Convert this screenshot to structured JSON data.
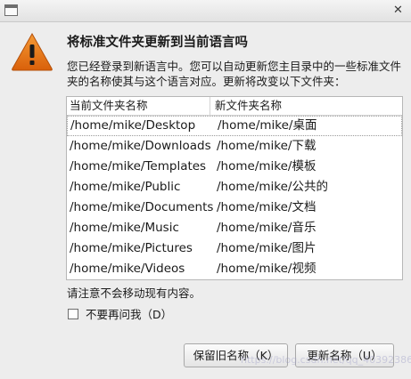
{
  "window": {
    "close_glyph": "✕"
  },
  "dialog": {
    "heading": "将标准文件夹更新到当前语言吗",
    "description": "您已经登录到新语言中。您可以自动更新您主目录中的一些标准文件夹的名称使其与这个语言对应。更新将改变以下文件夹：",
    "warning_icon": "warning-triangle-icon",
    "warning_color": "#e8730f",
    "table": {
      "headers": [
        "当前文件夹名称",
        "新文件夹名称"
      ],
      "rows": [
        [
          "/home/mike/Desktop",
          "/home/mike/桌面"
        ],
        [
          "/home/mike/Downloads",
          "/home/mike/下载"
        ],
        [
          "/home/mike/Templates",
          "/home/mike/模板"
        ],
        [
          "/home/mike/Public",
          "/home/mike/公共的"
        ],
        [
          "/home/mike/Documents",
          "/home/mike/文档"
        ],
        [
          "/home/mike/Music",
          "/home/mike/音乐"
        ],
        [
          "/home/mike/Pictures",
          "/home/mike/图片"
        ],
        [
          "/home/mike/Videos",
          "/home/mike/视频"
        ]
      ]
    },
    "note": "请注意不会移动现有内容。",
    "checkbox_label": "不要再问我（D）",
    "checkbox_checked": false,
    "buttons": {
      "keep": "保留旧名称（K）",
      "update": "更新名称（U）"
    }
  },
  "watermark": "https://blog.csdn.net/qq_40392386"
}
